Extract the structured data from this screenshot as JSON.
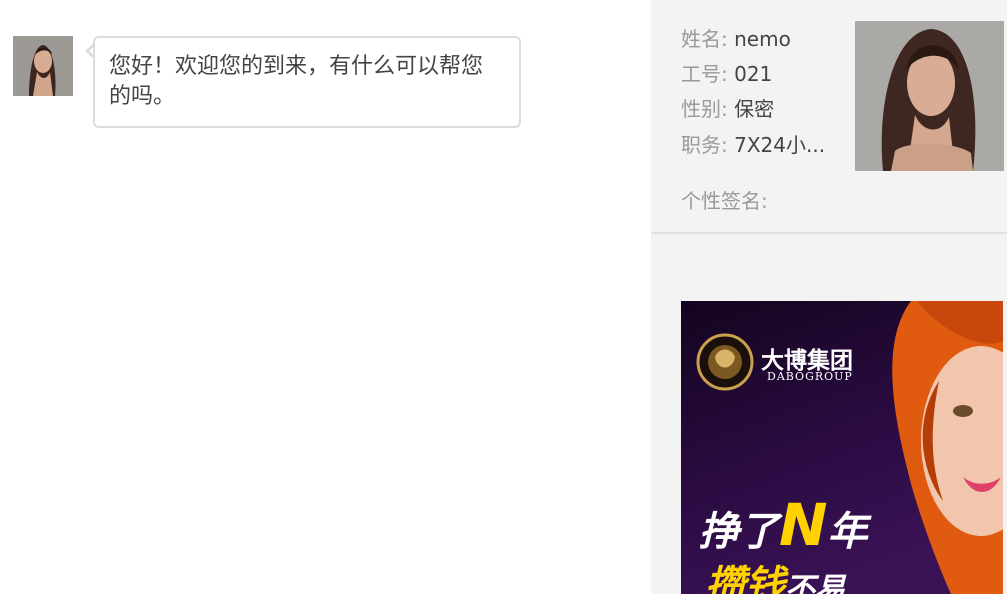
{
  "chat": {
    "messages": [
      {
        "sender": "agent",
        "text": "您好！欢迎您的到来，有什么可以帮您的吗。"
      }
    ]
  },
  "agent_info": {
    "name_label": "姓名:",
    "name_value": "nemo",
    "id_label": "工号:",
    "id_value": "021",
    "gender_label": "性别:",
    "gender_value": "保密",
    "position_label": "职务:",
    "position_value": "7X24小...",
    "signature_label": "个性签名:",
    "signature_value": ""
  },
  "ad_banner": {
    "brand_name": "大博集团",
    "brand_sub": "DABOGROUP",
    "slogan_line1_a": "挣了",
    "slogan_line1_b": "N",
    "slogan_line1_c": "年",
    "slogan_line2_a": "攒钱",
    "slogan_line2_b": "不易"
  },
  "colors": {
    "chat_bg": "#ffffff",
    "sidebar_bg": "#f3f3f3",
    "bubble_border": "#dcdcdc",
    "label_text": "#999999",
    "value_text": "#444444",
    "ad_accent": "#ffd200"
  },
  "icons": {
    "message_avatar": "agent-avatar-icon",
    "profile_photo": "agent-profile-photo"
  }
}
